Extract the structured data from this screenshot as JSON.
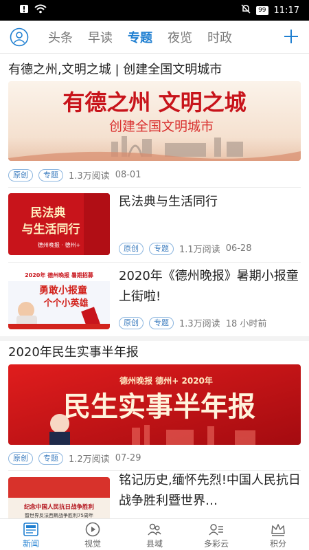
{
  "status_bar": {
    "battery": "99",
    "time": "11:17"
  },
  "top_nav": {
    "tabs": [
      {
        "label": "头条"
      },
      {
        "label": "早读"
      },
      {
        "label": "专题"
      },
      {
        "label": "夜览"
      },
      {
        "label": "时政"
      }
    ],
    "active_tab": "专题"
  },
  "feed": {
    "item1": {
      "title": "有德之州,文明之城 | 创建全国文明城市",
      "banner_main": "有德之州  文明之城",
      "banner_sub": "创建全国文明城市",
      "tag1": "原创",
      "tag2": "专题",
      "reads": "1.3万阅读",
      "date": "08-01"
    },
    "item2": {
      "title": "民法典与生活同行",
      "thumb_line1": "民法典",
      "thumb_line2": "与生活同行",
      "thumb_small": "德州晚报 · 德州+",
      "tag1": "原创",
      "tag2": "专题",
      "reads": "1.1万阅读",
      "date": "06-28"
    },
    "item3": {
      "title": "2020年《德州晚报》暑期小报童上街啦!",
      "thumb_top": "2020年 德州晚报 暑期招募",
      "thumb_line1": "勇敢小报童",
      "thumb_line2": "个个小英雄",
      "tag1": "原创",
      "tag2": "专题",
      "reads": "1.3万阅读",
      "date": "18 小时前"
    },
    "item4": {
      "title": "2020年民生实事半年报",
      "banner_top": "德州晚报 德州+ 2020年",
      "banner_main": "民生实事半年报",
      "tag1": "原创",
      "tag2": "专题",
      "reads": "1.2万阅读",
      "date": "07-29"
    },
    "item5": {
      "title": "铭记历史,缅怀先烈!中国人民抗日战争胜利暨世界…",
      "thumb_line1": "纪念中国人民抗日战争胜利",
      "thumb_line2": "暨世界反法西斯战争胜利75周年"
    }
  },
  "bottom_nav": {
    "items": [
      {
        "label": "新闻",
        "icon": "news-icon"
      },
      {
        "label": "视觉",
        "icon": "play-icon"
      },
      {
        "label": "县域",
        "icon": "people-icon"
      },
      {
        "label": "多彩云",
        "icon": "cloud-icon"
      },
      {
        "label": "积分",
        "icon": "crown-icon"
      }
    ],
    "active": "新闻"
  },
  "colors": {
    "accent": "#1f7fd1",
    "banner_red": "#c8141b",
    "tag_border": "#8bb5df"
  }
}
